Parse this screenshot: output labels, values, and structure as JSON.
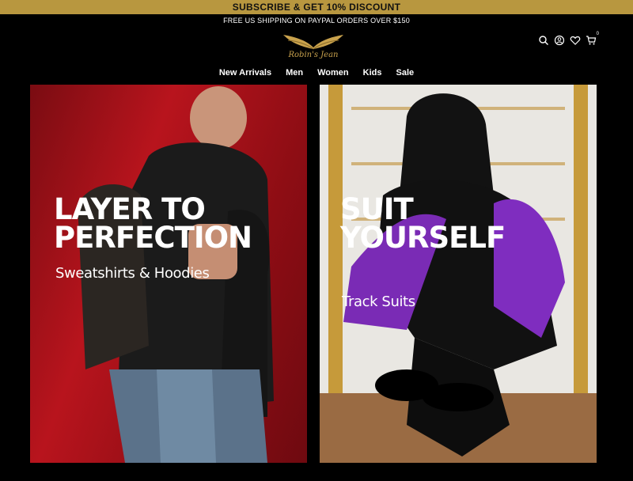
{
  "promo": {
    "text": "SUBSCRIBE & GET 10% DISCOUNT"
  },
  "shipping": {
    "text": "FREE US SHIPPING ON PAYPAL ORDERS OVER $150"
  },
  "brand": {
    "name": "Robin's Jean",
    "accent": "#b8973f"
  },
  "header_icons": {
    "items": [
      "search-icon",
      "account-icon",
      "wishlist-icon",
      "cart-icon"
    ],
    "cart_count": "0"
  },
  "nav": {
    "items": [
      "New Arrivals",
      "Men",
      "Women",
      "Kids",
      "Sale"
    ]
  },
  "panels": [
    {
      "headline_line1": "LAYER TO",
      "headline_line2": "PERFECTION",
      "subtitle": "Sweatshirts & Hoodies"
    },
    {
      "headline_line1": "SUIT",
      "headline_line2": "YOURSELF",
      "subtitle": "Track Suits"
    }
  ]
}
